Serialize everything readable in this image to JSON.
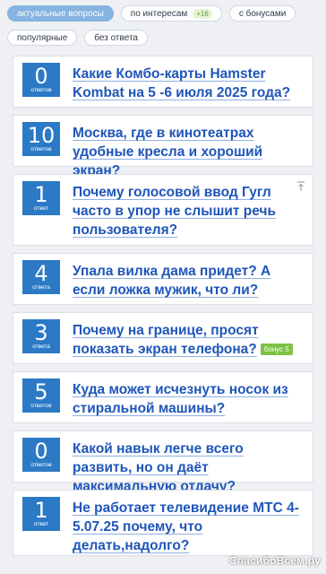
{
  "filters": [
    {
      "label": "актуальные вопросы",
      "active": true
    },
    {
      "label": "по интересам",
      "count": "+16"
    },
    {
      "label": "с бонусами"
    },
    {
      "label": "популярные"
    },
    {
      "label": "без ответа"
    }
  ],
  "questions": [
    {
      "answers": "0",
      "answers_word": "ответов",
      "title": "Какие Комбо-карты Hamster Kombat на 5 -6 июля 2025 года?"
    },
    {
      "answers": "10",
      "answers_word": "ответов",
      "title": "Москва, где в кинотеатрах удобные кресла и хороший экран?"
    },
    {
      "answers": "1",
      "answers_word": "ответ",
      "title": "Почему голосовой ввод Гугл часто в упор не слышит речь пользователя?",
      "pinned": true
    },
    {
      "answers": "4",
      "answers_word": "ответа",
      "title": "Упала вилка дама придет? А если ложка мужик, что ли?"
    },
    {
      "answers": "3",
      "answers_word": "ответа",
      "title": "Почему на границе, просят показать экран телефона?",
      "bonus": "бонус 5"
    },
    {
      "answers": "5",
      "answers_word": "ответов",
      "title": "Куда может исчезнуть носок из стиральной машины?"
    },
    {
      "answers": "0",
      "answers_word": "ответов",
      "title": "Какой навык легче всего развить, но он даёт максимальную отдачу?"
    },
    {
      "answers": "1",
      "answers_word": "ответ",
      "title": "Не работает телевидение МТС 4-5.07.25 почему, что делать,надолго?"
    }
  ],
  "watermark": "СпасибоВсем.ру",
  "colors": {
    "accent": "#2c7ac5",
    "link": "#1f56b9",
    "bonus": "#7dc243",
    "active_chip": "#84b4df"
  }
}
